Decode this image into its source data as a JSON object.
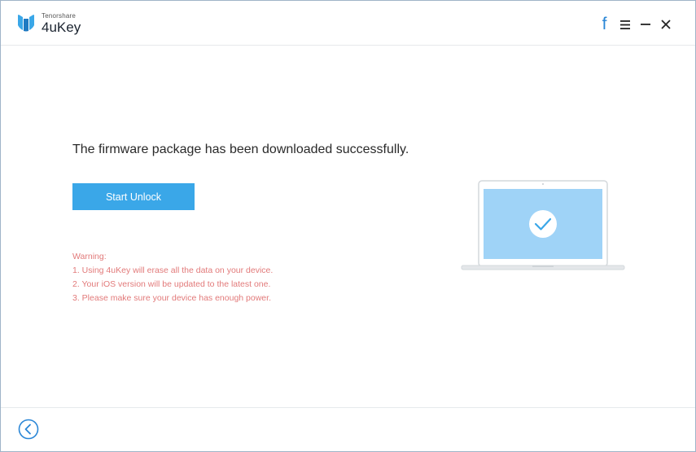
{
  "app": {
    "vendor": "Tenorshare",
    "name": "4uKey"
  },
  "window_controls": {
    "facebook": "f",
    "menu_icon": "menu-icon",
    "minimize_icon": "minimize-icon",
    "close_icon": "close-icon"
  },
  "main": {
    "headline": "The firmware package has been downloaded successfully.",
    "primary_button": "Start Unlock",
    "warning": {
      "title": "Warning:",
      "items": [
        "1. Using 4uKey will erase all the data on your device.",
        "2. Your iOS version will be updated to the latest one.",
        "3. Please make sure your device has enough power."
      ]
    }
  },
  "footer": {
    "back_icon": "back-arrow-icon"
  },
  "colors": {
    "accent": "#3aa7e8",
    "warning": "#e27a7a",
    "facebook": "#2a86d6",
    "screen": "#9fd3f7"
  }
}
